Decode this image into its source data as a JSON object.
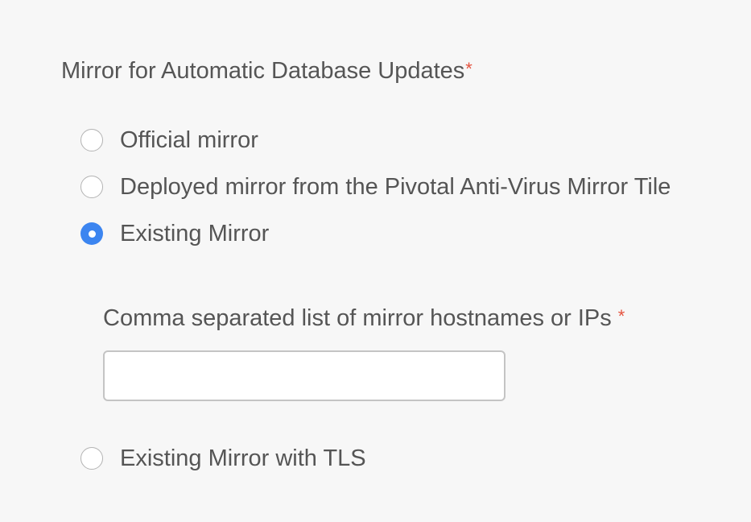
{
  "form": {
    "title": "Mirror for Automatic Database Updates",
    "required_marker": "*",
    "options": [
      {
        "label": "Official mirror",
        "checked": false
      },
      {
        "label": "Deployed mirror from the Pivotal Anti-Virus Mirror Tile",
        "checked": false
      },
      {
        "label": "Existing Mirror",
        "checked": true
      },
      {
        "label": "Existing Mirror with TLS",
        "checked": false
      }
    ],
    "hostnames_field": {
      "label": "Comma separated list of mirror hostnames or IPs",
      "required_marker": "*",
      "value": "",
      "placeholder": ""
    }
  },
  "colors": {
    "accent": "#3c85f0",
    "required": "#e5533f",
    "text": "#555555",
    "background": "#f7f7f7"
  }
}
